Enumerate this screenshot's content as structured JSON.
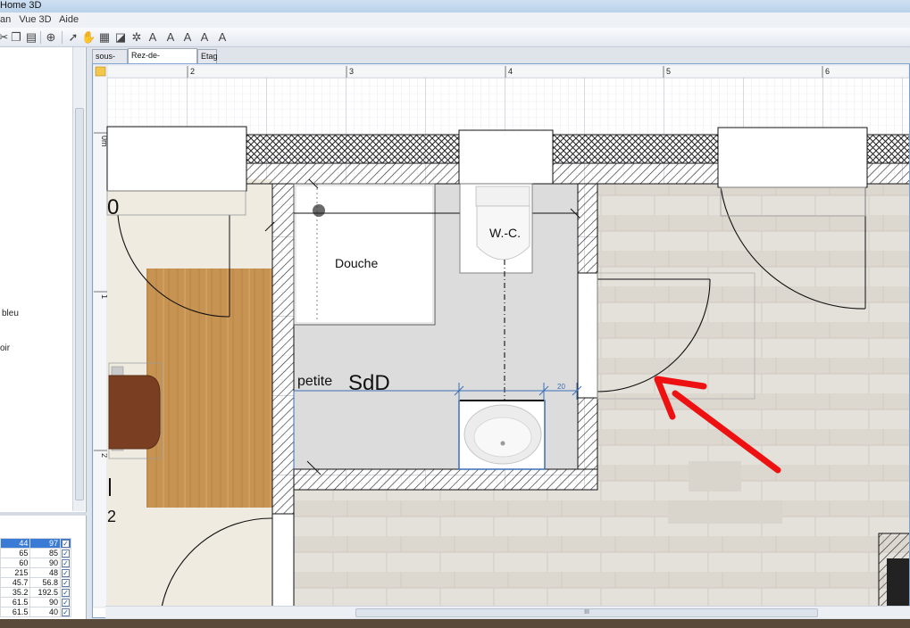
{
  "window": {
    "title": "Home 3D"
  },
  "menu": {
    "items": [
      "an",
      "Vue 3D",
      "Aide"
    ]
  },
  "toolbar": {
    "buttons": [
      "cut-icon",
      "copy-icon",
      "paste-icon",
      "add-furniture-icon",
      "select-icon",
      "pan-icon",
      "create-walls-icon",
      "create-rooms-icon",
      "create-polylines-icon",
      "create-dimensions-icon",
      "add-text-icon",
      "increase-text-icon",
      "decrease-text-icon",
      "bold-icon",
      "italic-icon"
    ]
  },
  "left_panel": {
    "fragments": [
      "bleu",
      "oir"
    ]
  },
  "furniture_table": {
    "rows": [
      {
        "w": "44",
        "d": "97",
        "visible": true,
        "selected": true
      },
      {
        "w": "65",
        "d": "85",
        "visible": true,
        "selected": false
      },
      {
        "w": "60",
        "d": "90",
        "visible": true,
        "selected": false
      },
      {
        "w": "215",
        "d": "48",
        "visible": true,
        "selected": false
      },
      {
        "w": "45.7",
        "d": "56.8",
        "visible": true,
        "selected": false
      },
      {
        "w": "35.2",
        "d": "192.5",
        "visible": true,
        "selected": false
      },
      {
        "w": "61.5",
        "d": "90",
        "visible": true,
        "selected": false
      },
      {
        "w": "61.5",
        "d": "40",
        "visible": true,
        "selected": false
      }
    ]
  },
  "levels": {
    "tabs": [
      "sous-sol",
      "Rez-de-chaussée",
      "Etag"
    ],
    "active": 1
  },
  "plan": {
    "ruler_top": [
      "2",
      "3",
      "4",
      "5",
      "6"
    ],
    "ruler_left": [
      "0m",
      "1",
      "2"
    ],
    "labels": {
      "douche": "Douche",
      "wc": "W.-C.",
      "room_small": "petite",
      "room_big": "SdD",
      "dimension": "20",
      "left_zero": "0",
      "left_two": "2"
    },
    "hscroll_grip": "III",
    "arrow_color": "#ee1111",
    "selection_color": "#3b6fb6"
  }
}
